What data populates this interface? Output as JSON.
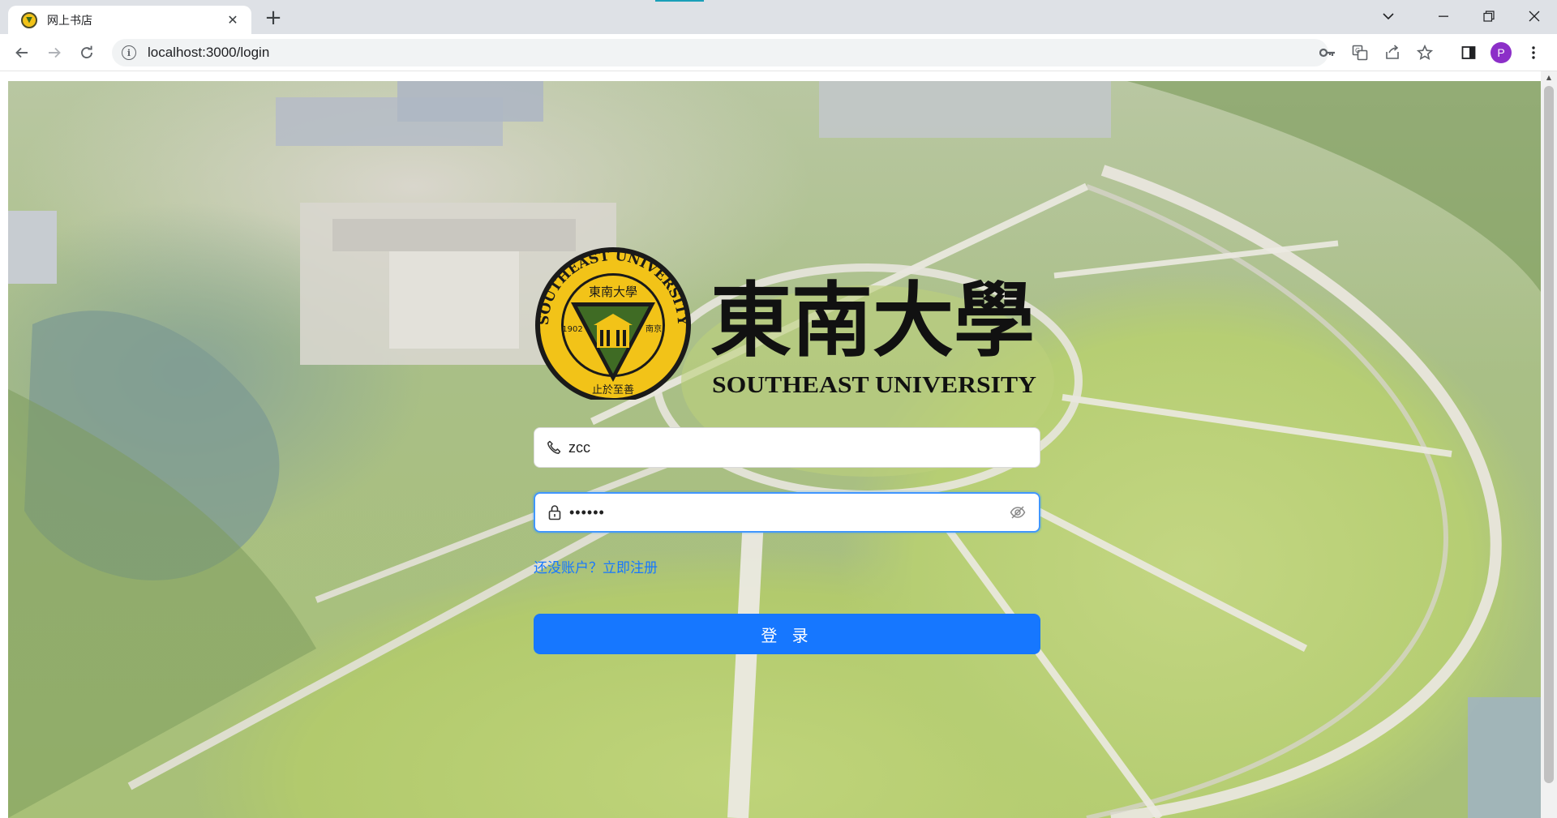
{
  "browser": {
    "tab": {
      "title": "网上书店",
      "favicon": "seu-emblem-icon"
    },
    "url": "localhost:3000/login",
    "profile_initial": "P",
    "colors": {
      "profile_avatar": "#8c2fc8"
    }
  },
  "page": {
    "logo": {
      "ring_text": "SOUTHEAST UNIVERSITY",
      "inner_title": "東南大學",
      "year": "1902",
      "city": "南京",
      "motto": "止於至善",
      "wordmark_cn": "東南大學",
      "wordmark_en": "SOUTHEAST UNIVERSITY"
    },
    "login_form": {
      "username_value": "zcc",
      "password_mask": "••••••",
      "register_link": "还没账户？立即注册",
      "submit_label": "登 录"
    },
    "colors": {
      "primary": "#1677ff",
      "focus_border": "#4096ff"
    }
  }
}
